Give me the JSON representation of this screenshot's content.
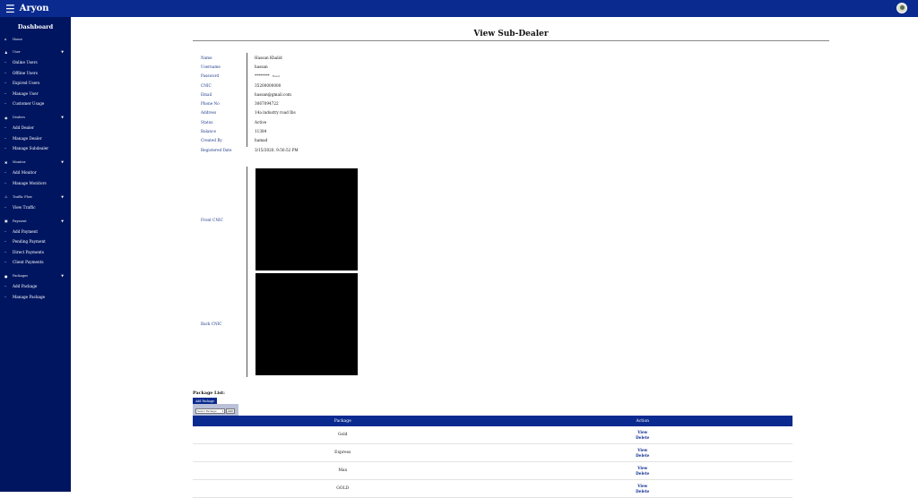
{
  "app": {
    "brand": "Aryon",
    "menu_icon": "hamburger-icon",
    "avatar_icon": "user-avatar-icon"
  },
  "colors": {
    "topbar": "#0a2a8f",
    "sidebar": "#001560",
    "table_header": "#0a2a8f",
    "label_blue": "#1f3a8a"
  },
  "sidebar": {
    "title": "Dashboard",
    "home": "Home",
    "sections": [
      {
        "label": "User",
        "icon": "user-icon",
        "items": [
          "Online Users",
          "Offline Users",
          "Expired Users",
          "Manage User",
          "Customer Usage"
        ]
      },
      {
        "label": "Dealers",
        "icon": "dealers-icon",
        "items": [
          "Add Dealer",
          "Manage Dealer",
          "Manage Subdealer"
        ]
      },
      {
        "label": "Monitor",
        "icon": "monitor-icon",
        "items": [
          "Add Monitor",
          "Manage Monitors"
        ]
      },
      {
        "label": "Traffic Flow",
        "icon": "traffic-icon",
        "items": [
          "View Traffic"
        ]
      },
      {
        "label": "Payment",
        "icon": "payment-icon",
        "items": [
          "Add Payment",
          "Pending Payment",
          "Direct Payments",
          "Client Payments"
        ]
      },
      {
        "label": "Packages",
        "icon": "packages-icon",
        "items": [
          "Add Package",
          "Manage Package"
        ]
      }
    ]
  },
  "page": {
    "title": "View Sub-Dealer"
  },
  "details": [
    {
      "label": "Name",
      "value": "Hassan Khalid"
    },
    {
      "label": "Username",
      "value": "hassan"
    },
    {
      "label": "Password",
      "value": "********",
      "extra": "Reset"
    },
    {
      "label": "CNIC",
      "value": "35200000000"
    },
    {
      "label": "Email",
      "value": "hassan@gmail.com"
    },
    {
      "label": "Phone No",
      "value": "3067094722"
    },
    {
      "label": "Address",
      "value": "14a industry road Ibs"
    },
    {
      "label": "Status",
      "value": "Active"
    },
    {
      "label": "Balance",
      "value": "11384"
    },
    {
      "label": "Created By",
      "value": "hamad"
    },
    {
      "label": "Registered Date",
      "value": "3/15/2020, 9:50:52 PM"
    }
  ],
  "cnic": {
    "front_label": "Front CNIC",
    "back_label": "Back CNIC"
  },
  "packages": {
    "heading": "Package List:",
    "add_tab": "Add Package",
    "select_placeholder": "Select Package",
    "add_button": "Add",
    "columns": [
      "Package",
      "Action"
    ],
    "rows": [
      {
        "name": "Gold",
        "view": "View",
        "delete": "Delete"
      },
      {
        "name": "Express",
        "view": "View",
        "delete": "Delete"
      },
      {
        "name": "Max",
        "view": "View",
        "delete": "Delete"
      },
      {
        "name": "GOLD",
        "view": "View",
        "delete": "Delete"
      }
    ]
  }
}
